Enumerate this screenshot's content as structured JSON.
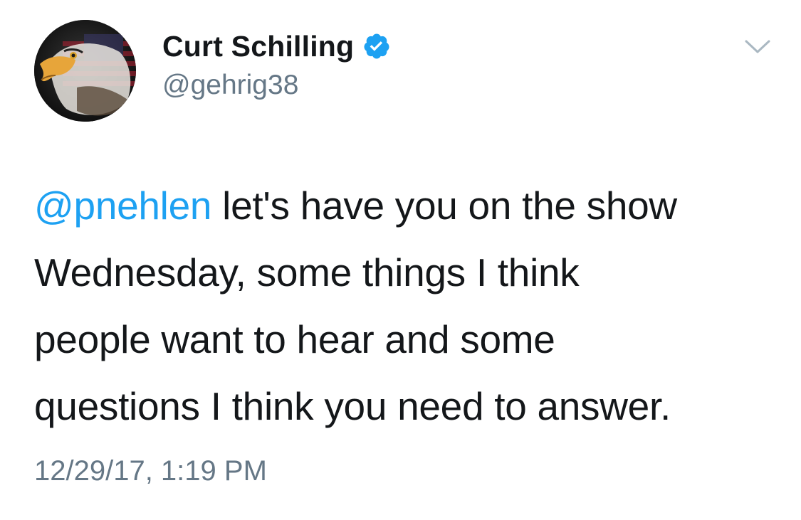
{
  "tweet": {
    "author": {
      "display_name": "Curt Schilling",
      "handle": "@gehrig38",
      "verified": true,
      "avatar": "eagle-flag-avatar"
    },
    "text": {
      "mention": "@pnehlen",
      "line1_rest": " let's have you on the show",
      "line2": "Wednesday, some things I think",
      "line3": "people want to hear and some",
      "line4": "questions I think you need to answer."
    },
    "timestamp": "12/29/17, 1:19 PM",
    "menu_icon": "chevron-down-icon"
  },
  "colors": {
    "text": "#14171a",
    "secondary": "#657786",
    "accent": "#1da1f2",
    "background": "#ffffff"
  }
}
